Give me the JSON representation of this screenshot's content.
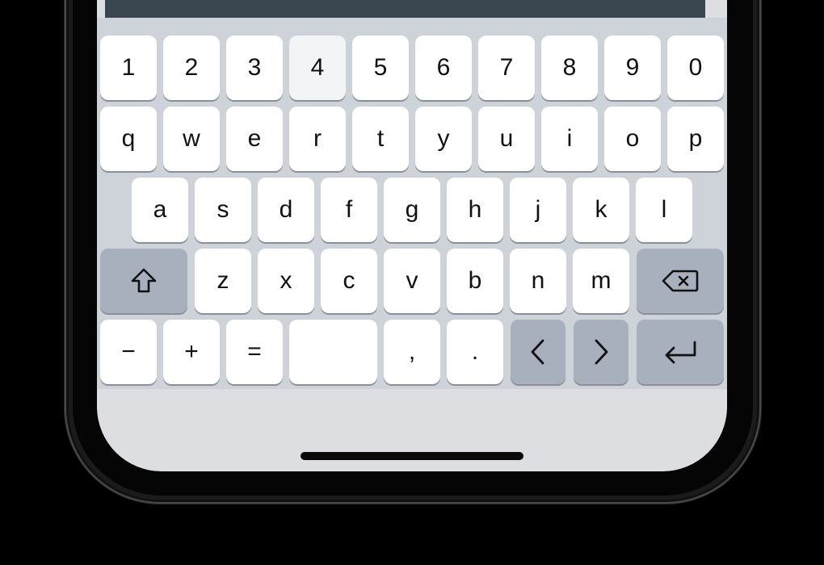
{
  "keyboard": {
    "number_row": [
      "1",
      "2",
      "3",
      "4",
      "5",
      "6",
      "7",
      "8",
      "9",
      "0"
    ],
    "top_row": [
      "q",
      "w",
      "e",
      "r",
      "t",
      "y",
      "u",
      "i",
      "o",
      "p"
    ],
    "middle_row": [
      "a",
      "s",
      "d",
      "f",
      "g",
      "h",
      "j",
      "k",
      "l"
    ],
    "bottom_row": [
      "z",
      "x",
      "c",
      "v",
      "b",
      "n",
      "m"
    ],
    "symbol_row": {
      "minus": "−",
      "plus": "+",
      "equals": "=",
      "space": "",
      "comma": ",",
      "period": "."
    },
    "pressed_key": "4",
    "icons": {
      "shift": "shift-icon",
      "backspace": "backspace-icon",
      "left": "chevron-left-icon",
      "right": "chevron-right-icon",
      "return": "return-icon"
    }
  },
  "colors": {
    "keyboard_background": "#ced3da",
    "letter_key": "#ffffff",
    "function_key": "#a8b0bd",
    "text_field_strip": "#394650",
    "screen_bottom": "#dcdee2"
  }
}
